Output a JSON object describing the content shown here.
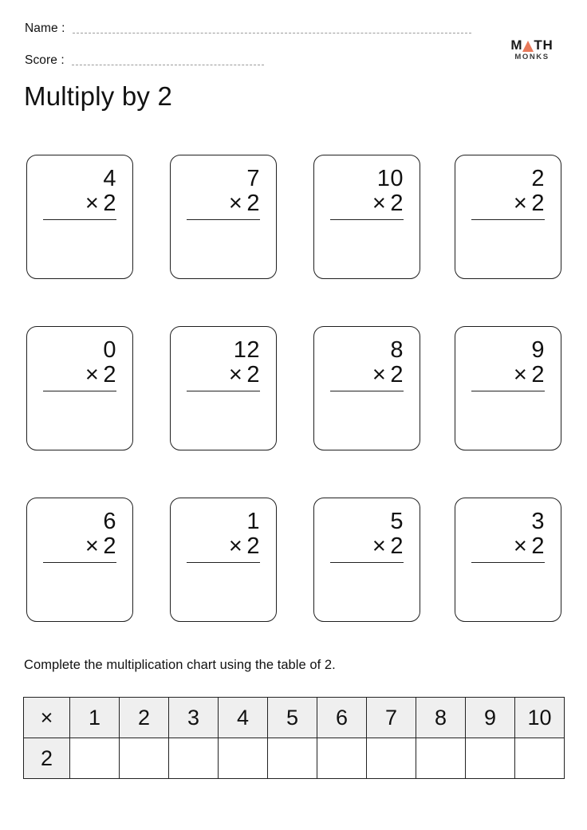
{
  "header": {
    "name_label": "Name :",
    "score_label": "Score :"
  },
  "logo": {
    "main_before": "M",
    "main_after": "TH",
    "sub": "MONKS",
    "triangle_color": "#e8795a",
    "triangle_name": "orange-triangle-a"
  },
  "title": "Multiply by 2",
  "problems": {
    "multiplier": "2",
    "operator": "×",
    "rows": [
      [
        {
          "top": "4",
          "operator": "×",
          "bottom": "2"
        },
        {
          "top": "7",
          "operator": "×",
          "bottom": "2"
        },
        {
          "top": "10",
          "operator": "×",
          "bottom": "2"
        },
        {
          "top": "2",
          "operator": "×",
          "bottom": "2"
        }
      ],
      [
        {
          "top": "0",
          "operator": "×",
          "bottom": "2"
        },
        {
          "top": "12",
          "operator": "×",
          "bottom": "2"
        },
        {
          "top": "8",
          "operator": "×",
          "bottom": "2"
        },
        {
          "top": "9",
          "operator": "×",
          "bottom": "2"
        }
      ],
      [
        {
          "top": "6",
          "operator": "×",
          "bottom": "2"
        },
        {
          "top": "1",
          "operator": "×",
          "bottom": "2"
        },
        {
          "top": "5",
          "operator": "×",
          "bottom": "2"
        },
        {
          "top": "3",
          "operator": "×",
          "bottom": "2"
        }
      ]
    ]
  },
  "instruction": "Complete the multiplication chart using the table of 2.",
  "chart_data": {
    "type": "table",
    "title": "Complete the multiplication chart using the table of 2.",
    "corner_label": "×",
    "columns": [
      "1",
      "2",
      "3",
      "4",
      "5",
      "6",
      "7",
      "8",
      "9",
      "10"
    ],
    "row_labels": [
      "2"
    ],
    "values": [
      [
        "",
        "",
        "",
        "",
        "",
        "",
        "",
        "",
        "",
        ""
      ]
    ],
    "header_fill": "#efefef",
    "row_label_fill": "#efefef",
    "cell_fill": "#ffffff",
    "border_color": "#222222"
  }
}
